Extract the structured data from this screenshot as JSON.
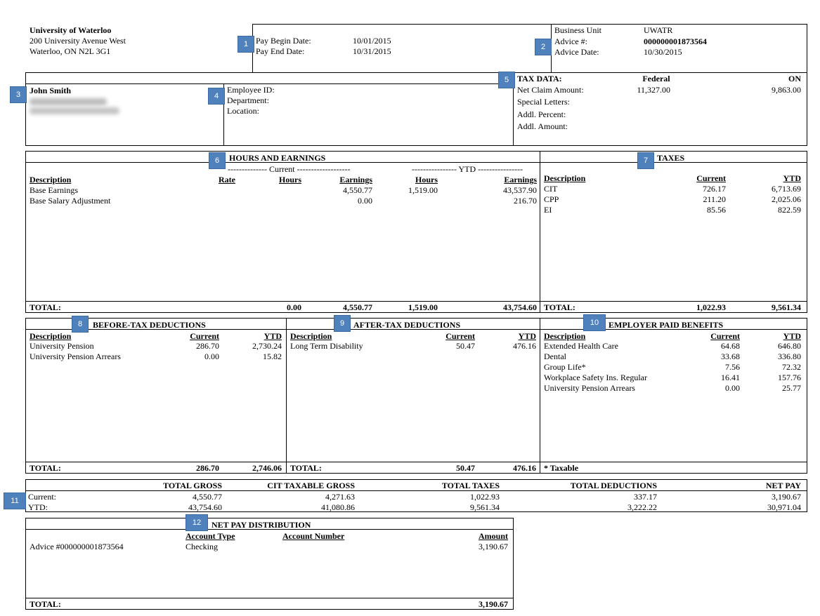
{
  "employer": {
    "name": "University of Waterloo",
    "address1": "200 University Avenue West",
    "address2": "Waterloo, ON  N2L 3G1"
  },
  "pay_period": {
    "begin_label": "Pay Begin Date:",
    "begin": "10/01/2015",
    "end_label": "Pay End Date:",
    "end": "10/31/2015"
  },
  "advice": {
    "unit_label": "Business Unit",
    "unit": "UWATR",
    "number_label": "Advice #:",
    "number": "000000001873564",
    "date_label": "Advice Date:",
    "date": "10/30/2015"
  },
  "employee": {
    "name": "John Smith",
    "id_label": "Employee ID:",
    "dept_label": "Department:",
    "location_label": "Location:"
  },
  "tax_data": {
    "title": "TAX DATA:",
    "federal": "Federal",
    "provincial": "ON",
    "net_claim_label": "Net Claim Amount:",
    "net_claim_federal": "11,327.00",
    "net_claim_provincial": "9,863.00",
    "special_label": "Special Letters:",
    "addl_percent_label": "Addl. Percent:",
    "addl_amount_label": "Addl. Amount:"
  },
  "earnings": {
    "title": "HOURS AND EARNINGS",
    "current_group": "-------------- Current -------------------",
    "ytd_group": "---------------- YTD ----------------",
    "headers": {
      "description": "Description",
      "rate": "Rate",
      "hours": "Hours",
      "earnings": "Earnings",
      "ytd_hours": "Hours",
      "ytd_earnings": "Earnings"
    },
    "rows": [
      {
        "description": "Base Earnings",
        "rate": "",
        "hours": "",
        "earnings": "4,550.77",
        "ytd_hours": "1,519.00",
        "ytd_earnings": "43,537.90"
      },
      {
        "description": "Base Salary Adjustment",
        "rate": "",
        "hours": "",
        "earnings": "0.00",
        "ytd_hours": "",
        "ytd_earnings": "216.70"
      }
    ],
    "total_label": "TOTAL:",
    "total_hours": "0.00",
    "total_earnings": "4,550.77",
    "total_ytd_hours": "1,519.00",
    "total_ytd_earnings": "43,754.60"
  },
  "taxes": {
    "title": "TAXES",
    "headers": {
      "description": "Description",
      "current": "Current",
      "ytd": "YTD"
    },
    "rows": [
      {
        "description": "CIT",
        "current": "726.17",
        "ytd": "6,713.69"
      },
      {
        "description": "CPP",
        "current": "211.20",
        "ytd": "2,025.06"
      },
      {
        "description": "EI",
        "current": "85.56",
        "ytd": "822.59"
      }
    ],
    "total_label": "TOTAL:",
    "total_current": "1,022.93",
    "total_ytd": "9,561.34"
  },
  "before_tax": {
    "title": "BEFORE-TAX DEDUCTIONS",
    "headers": {
      "description": "Description",
      "current": "Current",
      "ytd": "YTD"
    },
    "rows": [
      {
        "description": "University Pension",
        "current": "286.70",
        "ytd": "2,730.24"
      },
      {
        "description": "University Pension Arrears",
        "current": "0.00",
        "ytd": "15.82"
      }
    ],
    "total_label": "TOTAL:",
    "total_current": "286.70",
    "total_ytd": "2,746.06"
  },
  "after_tax": {
    "title": "AFTER-TAX DEDUCTIONS",
    "headers": {
      "description": "Description",
      "current": "Current",
      "ytd": "YTD"
    },
    "rows": [
      {
        "description": "Long Term Disability",
        "current": "50.47",
        "ytd": "476.16"
      }
    ],
    "total_label": "TOTAL:",
    "total_current": "50.47",
    "total_ytd": "476.16"
  },
  "benefits": {
    "title": "EMPLOYER PAID BENEFITS",
    "headers": {
      "description": "Description",
      "current": "Current",
      "ytd": "YTD"
    },
    "rows": [
      {
        "description": "Extended Health Care",
        "current": "64.68",
        "ytd": "646.80"
      },
      {
        "description": "Dental",
        "current": "33.68",
        "ytd": "336.80"
      },
      {
        "description": "Group Life*",
        "current": "7.56",
        "ytd": "72.32"
      },
      {
        "description": "Workplace Safety Ins. Regular",
        "current": "16.41",
        "ytd": "157.76"
      },
      {
        "description": "University Pension Arrears",
        "current": "0.00",
        "ytd": "25.77"
      }
    ],
    "footnote": "* Taxable"
  },
  "summary": {
    "headers": {
      "gross": "TOTAL GROSS",
      "cit": "CIT TAXABLE GROSS",
      "taxes": "TOTAL TAXES",
      "deductions": "TOTAL DEDUCTIONS",
      "net": "NET PAY"
    },
    "current_label": "Current:",
    "ytd_label": "YTD:",
    "current": {
      "gross": "4,550.77",
      "cit": "4,271.63",
      "taxes": "1,022.93",
      "deductions": "337.17",
      "net": "3,190.67"
    },
    "ytd": {
      "gross": "43,754.60",
      "cit": "41,080.86",
      "taxes": "9,561.34",
      "deductions": "3,222.22",
      "net": "30,971.04"
    }
  },
  "distribution": {
    "title": "NET PAY DISTRIBUTION",
    "headers": {
      "account_type": "Account Type",
      "account_number": "Account Number",
      "amount": "Amount"
    },
    "rows": [
      {
        "advice": "Advice #000000001873564",
        "account_type": "Checking",
        "account_number": "",
        "amount": "3,190.67"
      }
    ],
    "total_label": "TOTAL:",
    "total": "3,190.67"
  },
  "markers": [
    "1",
    "2",
    "3",
    "4",
    "5",
    "6",
    "7",
    "8",
    "9",
    "10",
    "11",
    "12"
  ],
  "colors": {
    "marker_fill": "#4f81bd",
    "marker_text": "#ffffff"
  }
}
